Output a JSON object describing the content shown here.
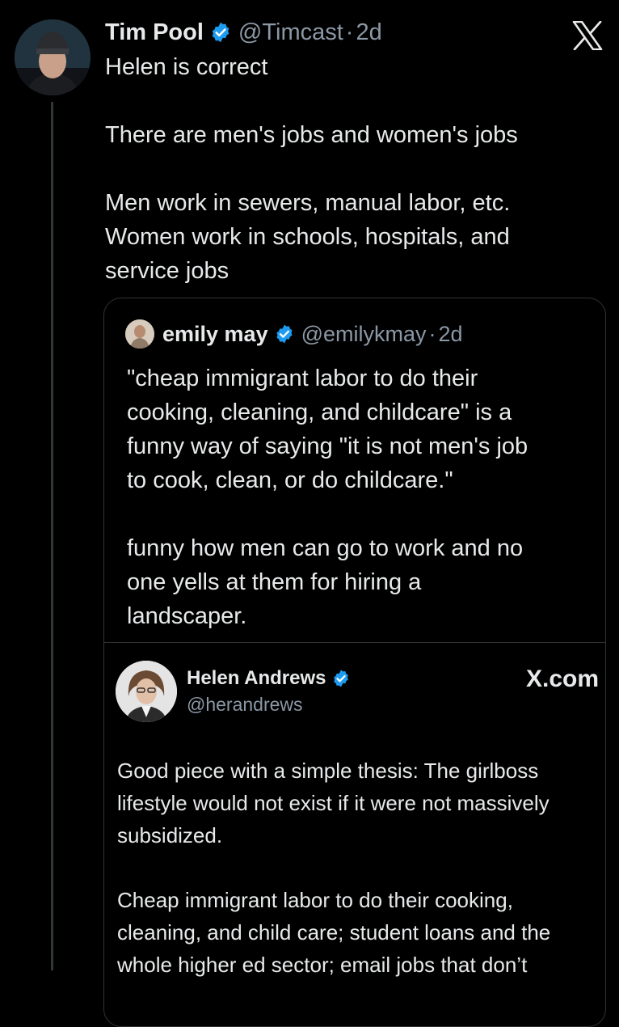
{
  "tweet": {
    "author_name": "Tim Pool",
    "handle": "@Timcast",
    "separator": "·",
    "time": "2d",
    "text": "Helen is correct\n\nThere are men's jobs and women's jobs\n\nMen work in sewers, manual labor, etc.\nWomen work in schools, hospitals, and\nservice jobs"
  },
  "quoted_tweet": {
    "author_name": "emily may",
    "handle": "@emilykmay",
    "separator": "·",
    "time": "2d",
    "text": "\"cheap immigrant labor to do their\ncooking, cleaning, and childcare\" is a\nfunny way of saying \"it is not men's job\nto cook, clean, or do childcare.\"\n\nfunny how men can go to work and no\none yells at them for hiring a\nlandscaper."
  },
  "embedded_post": {
    "author_name": "Helen Andrews",
    "handle": "@herandrews",
    "site": "X.com",
    "text": "Good piece with a simple thesis: The girlboss\nlifestyle would not exist if it were not massively\nsubsidized.\n\nCheap immigrant labor to do their cooking,\ncleaning, and child care; student loans and the\nwhole higher ed sector; email jobs that don’t"
  },
  "icons": {
    "verified": "verified-badge-icon",
    "logo": "x-logo-icon"
  },
  "colors": {
    "background": "#000000",
    "text": "#e7e9ea",
    "secondary": "#8b98a5",
    "verified": "#1d9bf0",
    "border": "#2f3336"
  }
}
